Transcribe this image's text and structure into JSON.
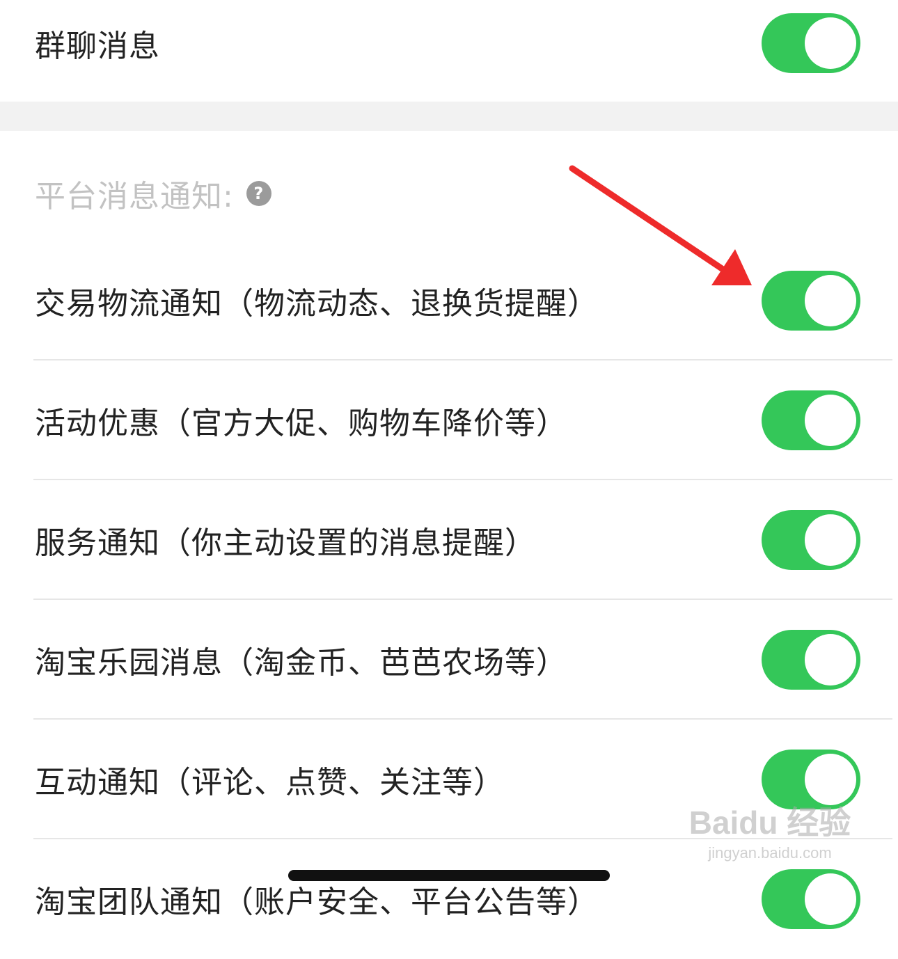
{
  "top_setting": {
    "label": "群聊消息",
    "enabled": true
  },
  "section": {
    "title": "平台消息通知:",
    "help_icon": "question-mark-icon",
    "items": [
      {
        "label": "交易物流通知（物流动态、退换货提醒）",
        "enabled": true
      },
      {
        "label": "活动优惠（官方大促、购物车降价等）",
        "enabled": true
      },
      {
        "label": "服务通知（你主动设置的消息提醒）",
        "enabled": true
      },
      {
        "label": "淘宝乐园消息（淘金币、芭芭农场等）",
        "enabled": true
      },
      {
        "label": "互动通知（评论、点赞、关注等）",
        "enabled": true
      },
      {
        "label": "淘宝团队通知（账户安全、平台公告等）",
        "enabled": true
      }
    ]
  },
  "colors": {
    "toggle_on": "#34c759",
    "annotation_arrow": "#ee2b2b"
  },
  "watermark": {
    "logo": "Baidu 经验",
    "url": "jingyan.baidu.com"
  }
}
